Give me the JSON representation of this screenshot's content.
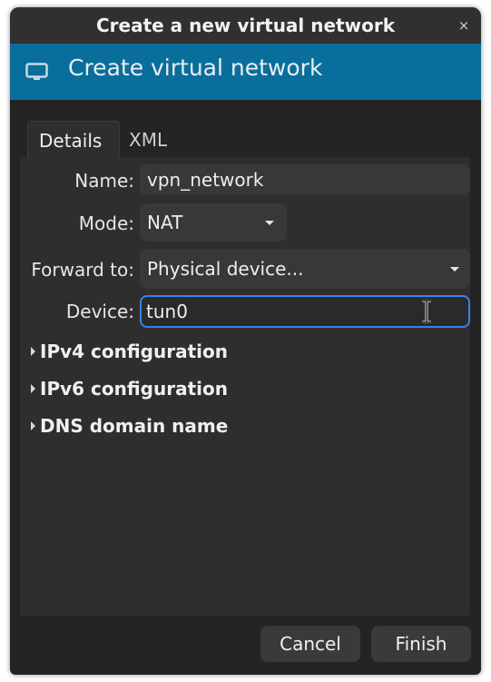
{
  "window": {
    "title": "Create a new virtual network",
    "close_glyph": "×"
  },
  "banner": {
    "icon": "network-monitor-icon",
    "title": "Create virtual network",
    "color": "#0a6e9c"
  },
  "tabs": [
    {
      "label": "Details",
      "active": true
    },
    {
      "label": "XML",
      "active": false
    }
  ],
  "form": {
    "name": {
      "label": "Name:",
      "value": "vpn_network"
    },
    "mode": {
      "label": "Mode:",
      "value": "NAT"
    },
    "forward": {
      "label": "Forward to:",
      "value": "Physical device..."
    },
    "device": {
      "label": "Device:",
      "value": "tun0"
    }
  },
  "expanders": [
    {
      "label": "IPv4 configuration"
    },
    {
      "label": "IPv6 configuration"
    },
    {
      "label": "DNS domain name"
    }
  ],
  "buttons": {
    "cancel": "Cancel",
    "finish": "Finish"
  },
  "colors": {
    "accent_focus": "#3584e4",
    "background": "#242424"
  }
}
